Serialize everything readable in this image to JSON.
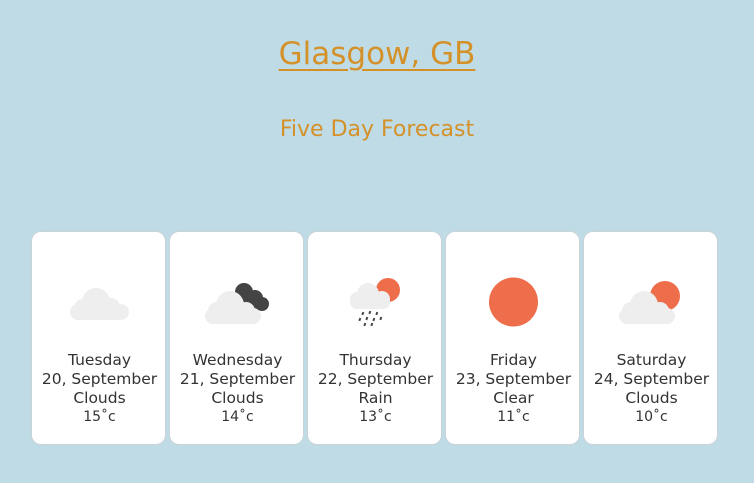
{
  "header": {
    "city": "Glasgow, GB",
    "subtitle": "Five Day Forecast"
  },
  "forecast": [
    {
      "day": "Tuesday",
      "date": "20, September",
      "condition": "Clouds",
      "temp": "15˚c",
      "icon": "cloud-icon"
    },
    {
      "day": "Wednesday",
      "date": "21, September",
      "condition": "Clouds",
      "temp": "14˚c",
      "icon": "dark-clouds-icon"
    },
    {
      "day": "Thursday",
      "date": "22, September",
      "condition": "Rain",
      "temp": "13˚c",
      "icon": "rain-sun-icon"
    },
    {
      "day": "Friday",
      "date": "23, September",
      "condition": "Clear",
      "temp": "11˚c",
      "icon": "sun-icon"
    },
    {
      "day": "Saturday",
      "date": "24, September",
      "condition": "Clouds",
      "temp": "10˚c",
      "icon": "cloud-sun-icon"
    }
  ],
  "colors": {
    "background": "#bfdce6",
    "accent": "#d4912a",
    "sun": "#ee6e4c",
    "cloud_light": "#eeeeee",
    "cloud_dark": "#444444"
  }
}
